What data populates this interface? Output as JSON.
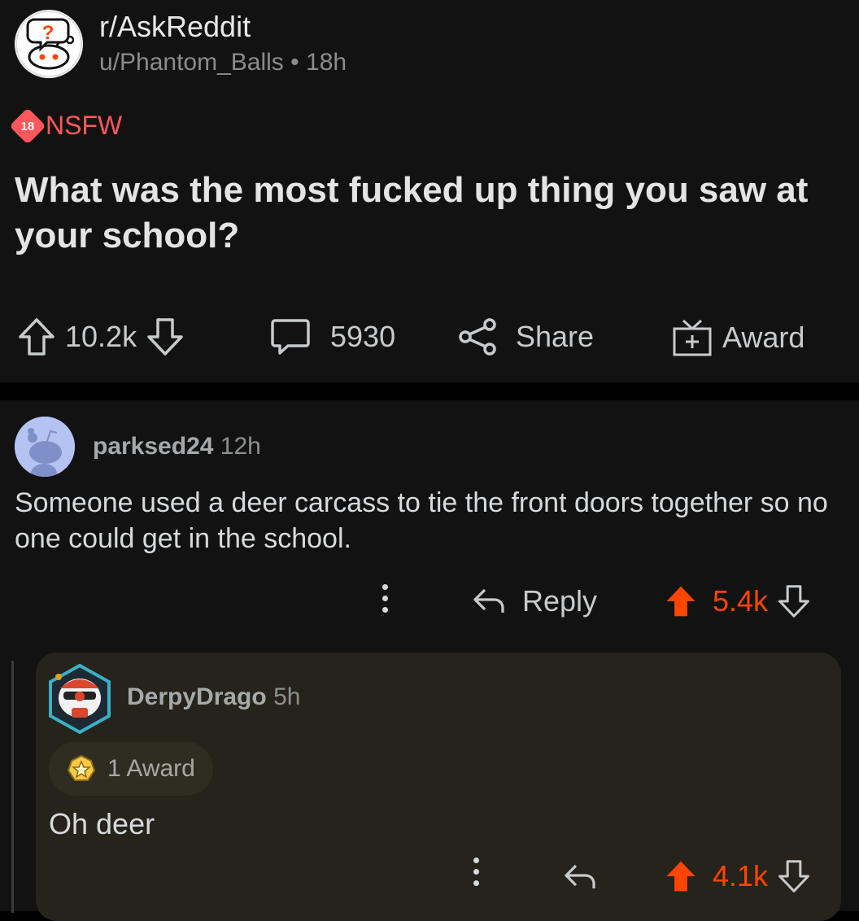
{
  "post": {
    "subreddit": "r/AskReddit",
    "author": "u/Phantom_Balls",
    "separator": "•",
    "age": "18h",
    "nsfw_badge": "18",
    "nsfw_label": "NSFW",
    "title": "What was the most fucked up thing you saw at your school?",
    "upvotes": "10.2k",
    "comments": "5930",
    "share_label": "Share",
    "award_label": "Award"
  },
  "comment": {
    "author": "parksed24",
    "age": "12h",
    "body": "Someone used a deer carcass to tie the front doors together so no one could get in the school.",
    "reply_label": "Reply",
    "score": "5.4k"
  },
  "reply": {
    "author": "DerpyDrago",
    "age": "5h",
    "award_text": "1 Award",
    "body": "Oh deer",
    "score": "4.1k"
  },
  "colors": {
    "background": "#121212",
    "upvote": "#ff4500",
    "nsfw": "#ff585b",
    "reply_bg": "#25231a"
  }
}
